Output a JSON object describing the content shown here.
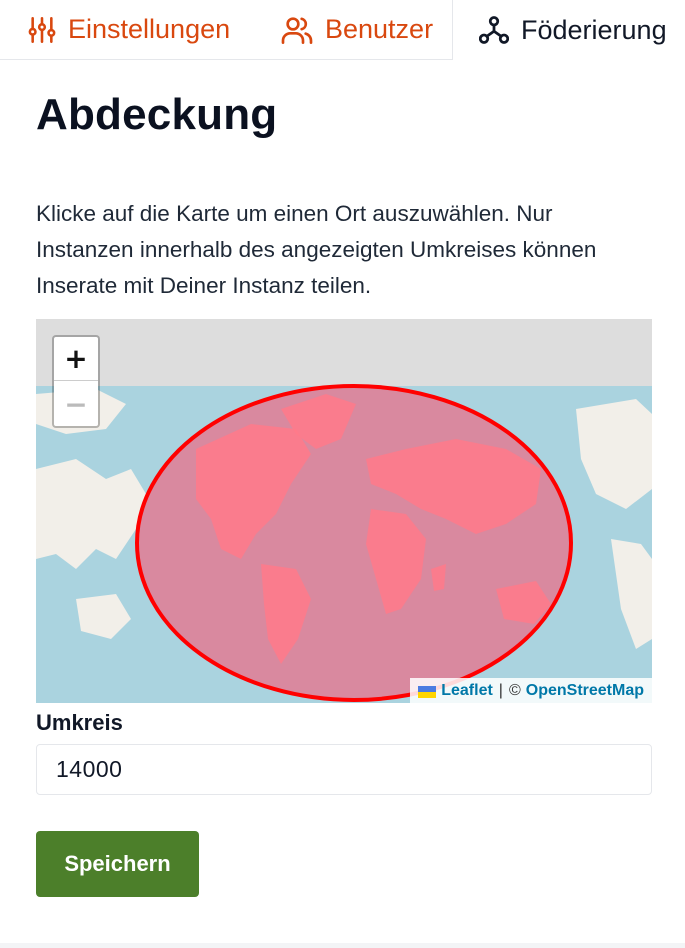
{
  "tabs": [
    {
      "label": "Einstellungen",
      "icon": "sliders-icon",
      "active": false
    },
    {
      "label": "Benutzer",
      "icon": "users-icon",
      "active": false
    },
    {
      "label": "Föderierung",
      "icon": "federation-icon",
      "active": true
    }
  ],
  "page": {
    "title": "Abdeckung",
    "description": "Klicke auf die Karte um einen Ort auszuwählen. Nur Instanzen innerhalb des angezeigten Umkreises können Inserate mit Deiner Instanz teilen."
  },
  "map": {
    "zoom_in_label": "+",
    "zoom_out_label": "−",
    "attribution": {
      "leaflet": "Leaflet",
      "separator": "|",
      "copyright": "©",
      "osm": "OpenStreetMap"
    },
    "circle_color": "#ff0000"
  },
  "form": {
    "radius_label": "Umkreis",
    "radius_value": "14000",
    "save_label": "Speichern"
  },
  "colors": {
    "accent": "#d9480f",
    "primary_button": "#4c7f2a",
    "link": "#0078a8"
  }
}
